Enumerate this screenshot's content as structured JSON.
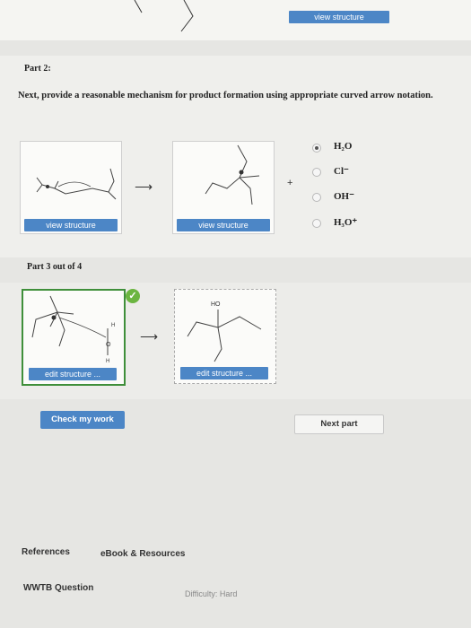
{
  "top": {
    "view_structure_label": "view structure"
  },
  "part2": {
    "label": "Part 2:",
    "instruction": "Next, provide a reasonable mechanism for product formation using appropriate curved arrow notation.",
    "left_box_button": "view structure",
    "right_box_button": "view structure",
    "arrow": "⟶",
    "plus": "+",
    "options": [
      {
        "label": "H₂O",
        "selected": true
      },
      {
        "label": "Cl⁻",
        "selected": false
      },
      {
        "label": "OH⁻",
        "selected": false
      },
      {
        "label": "H₃O⁺",
        "selected": false
      }
    ]
  },
  "part3": {
    "label": "Part 3 out of 4",
    "check_mark": "✓",
    "left_box_button": "edit structure ...",
    "right_box_button": "edit structure ...",
    "arrow": "⟶",
    "atom_ho": "HO",
    "atom_h1": "H",
    "atom_h2": "H",
    "atom_o": "O"
  },
  "actions": {
    "check_label": "Check my work",
    "next_label": "Next part"
  },
  "footer": {
    "references": "References",
    "ebook": "eBook & Resources",
    "question_type": "WWTB Question",
    "difficulty": "Difficulty: Hard"
  },
  "colors": {
    "accent": "#4c86c6",
    "check_green": "#6bb540"
  }
}
